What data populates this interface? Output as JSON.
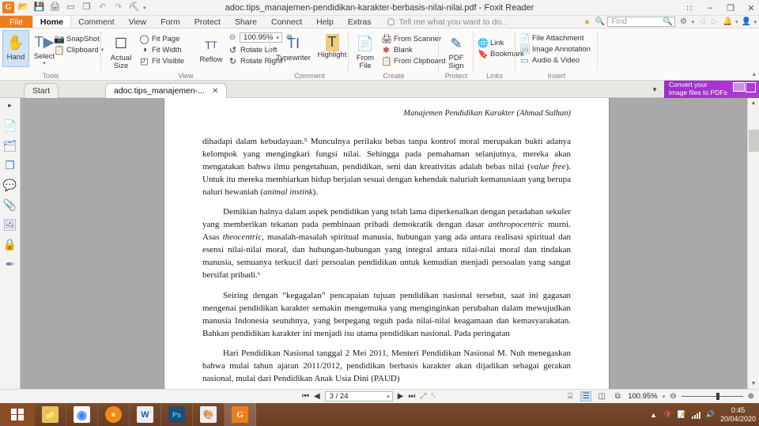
{
  "window": {
    "title": "adoc.tips_manajemen-pendidikan-karakter-berbasis-nilai-nilai.pdf - Foxit Reader",
    "app_logo": "G",
    "quick_access": [
      {
        "name": "open-icon",
        "glyph": "📂"
      },
      {
        "name": "save-icon",
        "glyph": "💾"
      },
      {
        "name": "print-icon",
        "glyph": "🖨"
      },
      {
        "name": "email-icon",
        "glyph": "▭"
      },
      {
        "name": "new-from-file-icon",
        "glyph": "❐"
      },
      {
        "name": "undo-icon",
        "glyph": "↶"
      },
      {
        "name": "redo-icon",
        "glyph": "↷"
      },
      {
        "name": "customize-icon",
        "glyph": "⛏"
      }
    ],
    "controls": [
      {
        "name": "restore-group-icon",
        "glyph": "∷"
      },
      {
        "name": "minimize-icon",
        "glyph": "–"
      },
      {
        "name": "maximize-icon",
        "glyph": "❐"
      },
      {
        "name": "close-icon",
        "glyph": "✕"
      }
    ]
  },
  "menu": {
    "tabs": [
      {
        "label": "File",
        "style": "file"
      },
      {
        "label": "Home",
        "style": "active"
      },
      {
        "label": "Comment",
        "style": ""
      },
      {
        "label": "View",
        "style": ""
      },
      {
        "label": "Form",
        "style": ""
      },
      {
        "label": "Protect",
        "style": ""
      },
      {
        "label": "Share",
        "style": ""
      },
      {
        "label": "Connect",
        "style": ""
      },
      {
        "label": "Help",
        "style": ""
      },
      {
        "label": "Extras",
        "style": ""
      }
    ],
    "tell_me": "Tell me what you want to do..",
    "find_placeholder": "Find"
  },
  "ribbon": {
    "groups": [
      {
        "label": "Tools"
      },
      {
        "label": "View"
      },
      {
        "label": "Comment"
      },
      {
        "label": "Create"
      },
      {
        "label": "Protect"
      },
      {
        "label": "Links"
      },
      {
        "label": "Insert"
      }
    ],
    "tools": {
      "hand": "Hand",
      "select": "Select",
      "snapshot": "SnapShot",
      "clipboard": "Clipboard"
    },
    "view": {
      "actual_size": "Actual\nSize",
      "actual_size_l1": "Actual",
      "actual_size_l2": "Size",
      "fit_page": "Fit Page",
      "fit_width": "Fit Width",
      "fit_visible": "Fit Visible",
      "reflow": "Reflow",
      "zoom_value": "100.95%"
    },
    "comment": {
      "typewriter": "Typewriter",
      "highlight": "Highlight"
    },
    "create": {
      "from_file_l1": "From",
      "from_file_l2": "File",
      "from_scanner": "From Scanner",
      "blank": "Blank",
      "from_clipboard": "From Clipboard"
    },
    "protect": {
      "pdf_sign_l1": "PDF",
      "pdf_sign_l2": "Sign"
    },
    "links": {
      "link": "Link",
      "bookmark": "Bookmark"
    },
    "insert": {
      "file_attachment": "File Attachment",
      "image_annotation": "Image Annotation",
      "audio_video": "Audio & Video"
    }
  },
  "doc_tabs": {
    "items": [
      {
        "label": "Start",
        "selected": false,
        "closable": false
      },
      {
        "label": "adoc.tips_manajemen-...",
        "selected": true,
        "closable": true
      }
    ],
    "close_glyph": "✕",
    "more_glyph": "▼"
  },
  "promo": {
    "line1": "Convert your",
    "line2": "image files to PDFs"
  },
  "navstrip": {
    "items": [
      {
        "name": "expand-panel-arrow-icon",
        "glyph": "▸"
      },
      {
        "name": "bookmarks-icon",
        "glyph": "📄"
      },
      {
        "name": "pages-thumbnails-icon",
        "glyph": "🗂"
      },
      {
        "name": "layers-icon",
        "glyph": "❐"
      },
      {
        "name": "comments-icon",
        "glyph": "💬"
      },
      {
        "name": "attachments-icon",
        "glyph": "📎"
      },
      {
        "name": "stamps-icon",
        "glyph": "🖼"
      },
      {
        "name": "security-lock-icon",
        "glyph": "🔒"
      },
      {
        "name": "digital-signature-icon",
        "glyph": "✒"
      }
    ]
  },
  "document": {
    "running_header": "Manajemen Pendidikan Karakter (Ahmad Sulhan)",
    "paragraphs": [
      "dihadapi dalam kebudayaan.⁵ Munculnya perilaku bebas tanpa kontrol moral merupakan bukti adanya  kelompok yang mengingkari fungsi nilai. Sehingga pada pemahaman selanjutnya,  mereka akan mengatakan bahwa ilmu pengetahuan, pendidikan, seni dan kreativitas adalah bebas nilai (value free). Untuk itu mereka membiarkan hidup  berjalan sesuai dengan kehendak naluriah kemanusiaan yang berupa naluri hewaniah (animal instink).",
      "Demikian halnya dalam aspek pendidikan yang telah lama diperkenalkan dengan peradaban sekuler yang memberikan tekanan pada pembinaan pribadi  demokratik dengan dasar anthropocentric murni. Asas theocentric, masalah-masalah spiritual manusia, hubungan yang ada antara realisasi spiritual dan esensi  nilai-nilai moral, dan hubungan-hubungan yang integral antara nilai-nilai moral  dan tindakan manusia, semuanya terkucil dari persoalan pendidikan untuk kemudian menjadi persoalan yang sangat bersifat pribadi.⁶",
      "Seiring dengan “kegagalan” pencapaian tujuan pendidikan nasional  tersebut, saat ini gagasan mengenai pendidikan karakter semakin mengemuka  yang menginginkan perubahan dalam mewujudkan manusia Indonesia seutuhnya,  yang berpegang teguh pada nilai-nilai keagamaan dan kemasyarakatan. Bahkan  pendidikan karakter ini menjadi isu utama pendidikan nasional. Pada peringatan",
      "Hari Pendidikan Nasional tanggal 2 Mei 2011, Menteri Pendidikan Nasional M. Nuh menegaskan bahwa mulai tahun ajaran 2011/2012, pendidikan berbasis karakter akan dijadikan sebagai gerakan nasional, mulai dari Pendidikan Anak  Usia Dini (PAUD)"
    ]
  },
  "status": {
    "first_page": "⏮",
    "prev_page": "◀",
    "page_value": "3 / 24",
    "next_page": "▶",
    "last_page": "⏭",
    "view_modes": [
      {
        "name": "single-page-view",
        "glyph": "⌸",
        "active": false
      },
      {
        "name": "continuous-view",
        "glyph": "☰",
        "active": true
      },
      {
        "name": "facing-view",
        "glyph": "◫",
        "active": false
      },
      {
        "name": "split-view",
        "glyph": "⧉",
        "active": false
      }
    ],
    "zoom_value": "100.95%",
    "zoom_out": "⊖",
    "zoom_in": "⊕"
  },
  "taskbar": {
    "items": [
      {
        "name": "file-explorer-icon",
        "label": "",
        "color": "#e8c35a",
        "glyph": "📁"
      },
      {
        "name": "chrome-icon",
        "label": "",
        "color": "#ffffff",
        "glyph": "◉"
      },
      {
        "name": "sun-app-icon",
        "label": "",
        "color": "#f08a1a",
        "glyph": "●"
      },
      {
        "name": "word-icon",
        "label": "W",
        "color": "#2b579a",
        "glyph": "W"
      },
      {
        "name": "photoshop-icon",
        "label": "Ps",
        "color": "#1d4f76",
        "glyph": "Ps"
      },
      {
        "name": "paint-icon",
        "label": "",
        "color": "#e9eef5",
        "glyph": "🎨"
      },
      {
        "name": "foxit-reader-icon",
        "label": "G",
        "color": "#f07d1a",
        "glyph": "G"
      }
    ],
    "tray": {
      "time": "0:45",
      "date": "20/04/2020"
    }
  }
}
